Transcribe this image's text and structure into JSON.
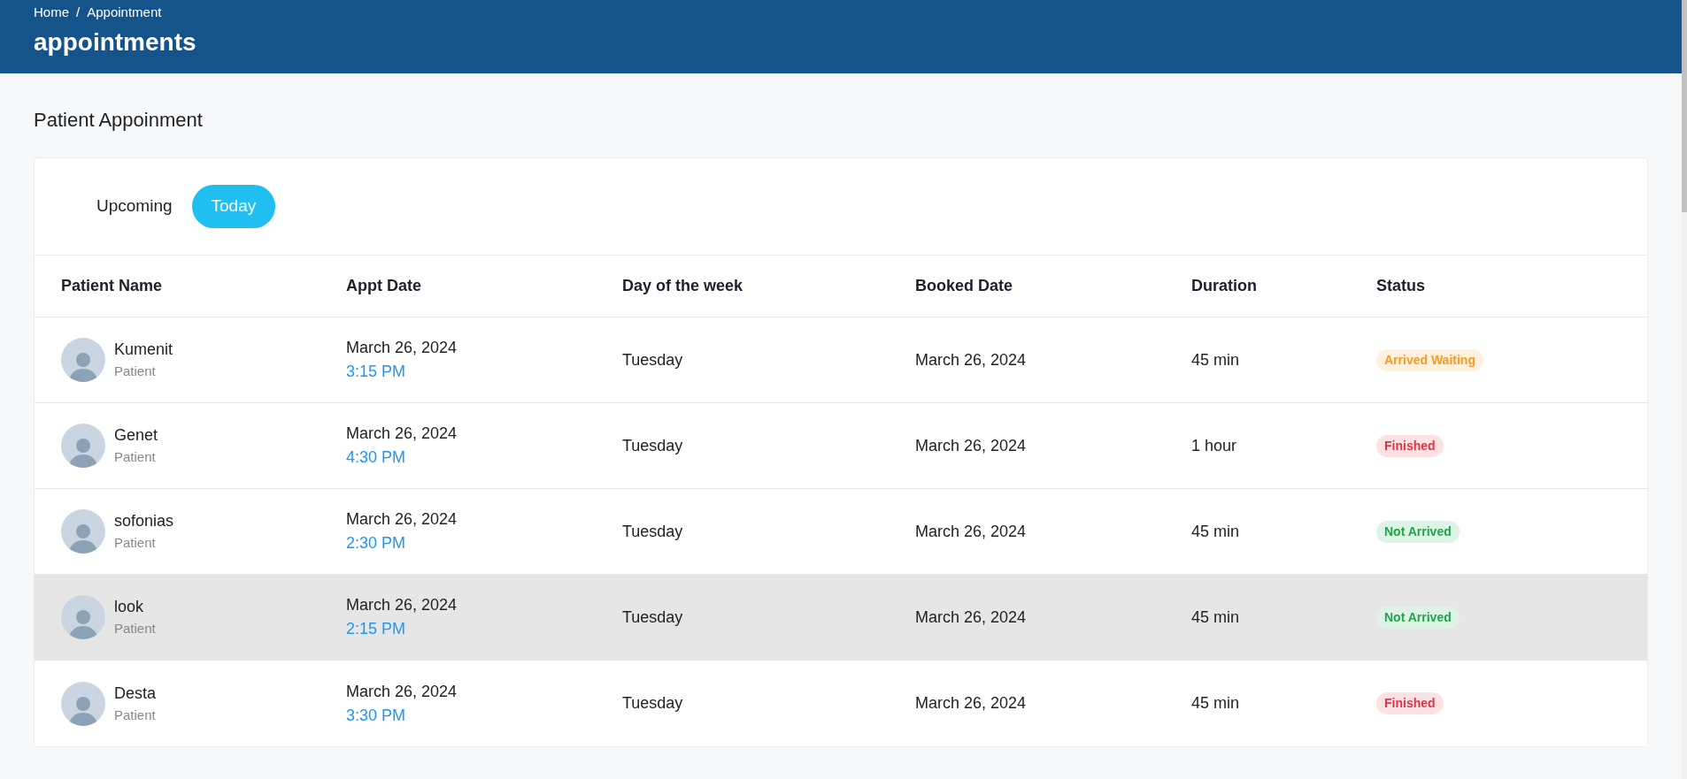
{
  "breadcrumb": [
    "Home",
    "Appointment"
  ],
  "breadcrumb_separator": "/",
  "page_title": "appointments",
  "section_title": "Patient Appoinment",
  "tabs": [
    {
      "label": "Upcoming",
      "selected": false
    },
    {
      "label": "Today",
      "selected": true
    }
  ],
  "table": {
    "columns": [
      "Patient Name",
      "Appt Date",
      "Day of the week",
      "Booked Date",
      "Duration",
      "Status"
    ],
    "rows": [
      {
        "name": "Kumenit",
        "role": "Patient",
        "appt_date": "March 26, 2024",
        "appt_time": "3:15 PM",
        "day": "Tuesday",
        "booked_date": "March 26, 2024",
        "duration": "45 min",
        "status": {
          "label": "Arrived Waiting",
          "kind": "warning"
        },
        "highlighted": false
      },
      {
        "name": "Genet",
        "role": "Patient",
        "appt_date": "March 26, 2024",
        "appt_time": "4:30 PM",
        "day": "Tuesday",
        "booked_date": "March 26, 2024",
        "duration": "1 hour",
        "status": {
          "label": "Finished",
          "kind": "danger"
        },
        "highlighted": false
      },
      {
        "name": "sofonias",
        "role": "Patient",
        "appt_date": "March 26, 2024",
        "appt_time": "2:30 PM",
        "day": "Tuesday",
        "booked_date": "March 26, 2024",
        "duration": "45 min",
        "status": {
          "label": "Not Arrived",
          "kind": "success"
        },
        "highlighted": false
      },
      {
        "name": "look",
        "role": "Patient",
        "appt_date": "March 26, 2024",
        "appt_time": "2:15 PM",
        "day": "Tuesday",
        "booked_date": "March 26, 2024",
        "duration": "45 min",
        "status": {
          "label": "Not Arrived",
          "kind": "success"
        },
        "highlighted": true
      },
      {
        "name": "Desta",
        "role": "Patient",
        "appt_date": "March 26, 2024",
        "appt_time": "3:30 PM",
        "day": "Tuesday",
        "booked_date": "March 26, 2024",
        "duration": "45 min",
        "status": {
          "label": "Finished",
          "kind": "danger"
        },
        "highlighted": false
      }
    ]
  }
}
